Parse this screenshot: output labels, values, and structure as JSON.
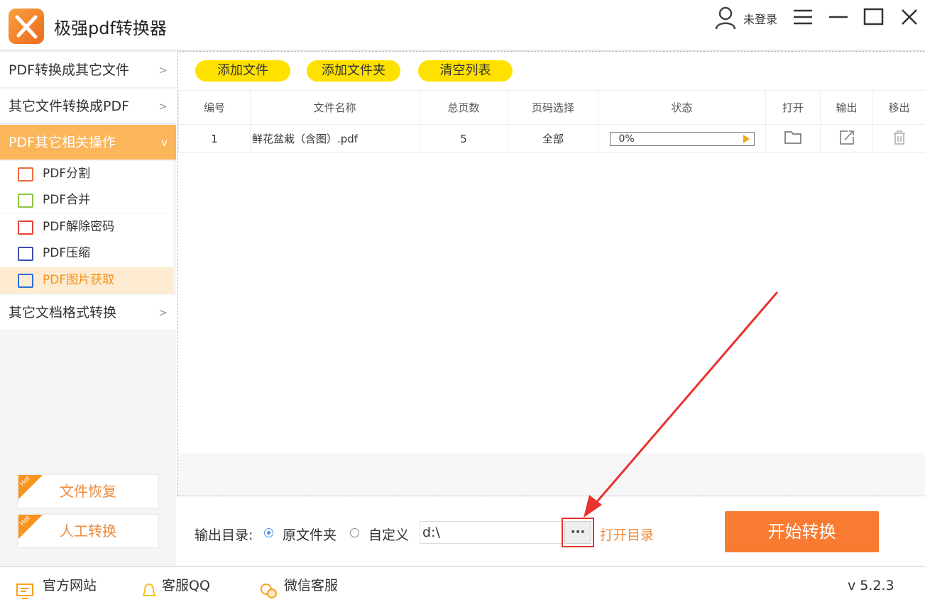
{
  "app": {
    "title": "极强pdf转换器",
    "user": "未登录",
    "version": "v 5.2.3"
  },
  "sidebar": {
    "items": [
      {
        "label": "PDF转换成其它文件",
        "chev": ">"
      },
      {
        "label": "其它文件转换成PDF",
        "chev": ">"
      },
      {
        "label": "PDF其它相关操作",
        "chev": "v"
      },
      {
        "label": "其它文档格式转换",
        "chev": ">"
      }
    ],
    "subitems": [
      {
        "label": "PDF分割",
        "color": "#f06a3a"
      },
      {
        "label": "PDF合并",
        "color": "#8cc63f"
      },
      {
        "label": "PDF解除密码",
        "color": "#e8413c"
      },
      {
        "label": "PDF压缩",
        "color": "#3b4fb0"
      },
      {
        "label": "PDF图片获取",
        "color": "#2f6fd6"
      }
    ],
    "hot": [
      {
        "label": "文件恢复",
        "badge": "Hot"
      },
      {
        "label": "人工转换",
        "badge": "Hot"
      }
    ]
  },
  "toolbar": {
    "add_file": "添加文件",
    "add_folder": "添加文件夹",
    "clear": "清空列表"
  },
  "table": {
    "headers": [
      "编号",
      "文件名称",
      "总页数",
      "页码选择",
      "状态",
      "打开",
      "输出",
      "移出"
    ],
    "rows": [
      {
        "no": "1",
        "name": "鲜花盆栽（含图）.pdf",
        "pages": "5",
        "range": "全部",
        "progress": "0%"
      }
    ]
  },
  "output": {
    "label": "输出目录:",
    "opt1": "原文件夹",
    "opt2": "自定义",
    "path": "d:\\",
    "browse": "···",
    "open_dir": "打开目录",
    "start": "开始转换"
  },
  "footer": {
    "site": "官方网站",
    "qq": "客服QQ",
    "wechat": "微信客服"
  }
}
